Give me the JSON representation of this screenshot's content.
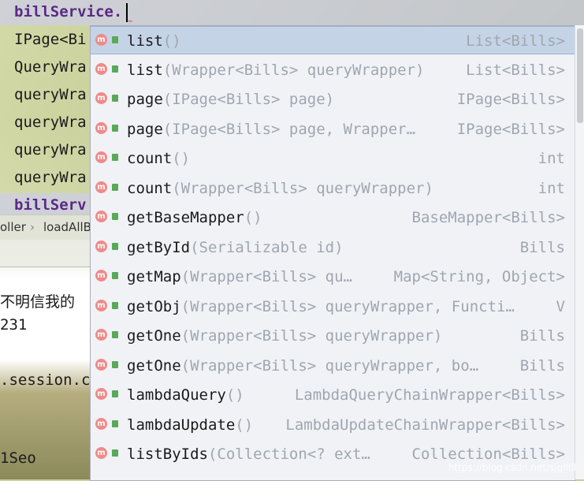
{
  "editor": {
    "lines": [
      {
        "text": "billService."
      },
      {
        "text": "IPage<Bi"
      },
      {
        "text": "QueryWra"
      },
      {
        "text": "queryWra"
      },
      {
        "text": "queryWra"
      },
      {
        "text": "queryWra"
      },
      {
        "text": "queryWra"
      },
      {
        "text": "billServ"
      }
    ]
  },
  "breadcrumb": {
    "item1": "oller",
    "separator": "›",
    "item2": "loadAllB"
  },
  "output": {
    "line1": "不明信我的",
    "line2": "231",
    "line3": ".session.c",
    "line4": "1Seo"
  },
  "completion": {
    "items": [
      {
        "name": "list",
        "params": "()",
        "type": "List<Bills>"
      },
      {
        "name": "list",
        "params": "(Wrapper<Bills> queryWrapper)",
        "type": "List<Bills>"
      },
      {
        "name": "page",
        "params": "(IPage<Bills> page)",
        "type": "IPage<Bills>"
      },
      {
        "name": "page",
        "params": "(IPage<Bills> page, Wrapper…",
        "type": "IPage<Bills>"
      },
      {
        "name": "count",
        "params": "()",
        "type": "int"
      },
      {
        "name": "count",
        "params": "(Wrapper<Bills> queryWrapper)",
        "type": "int"
      },
      {
        "name": "getBaseMapper",
        "params": "()",
        "type": "BaseMapper<Bills>"
      },
      {
        "name": "getById",
        "params": "(Serializable id)",
        "type": "Bills"
      },
      {
        "name": "getMap",
        "params": "(Wrapper<Bills> qu…",
        "type": "Map<String, Object>"
      },
      {
        "name": "getObj",
        "params": "(Wrapper<Bills> queryWrapper, Functi…",
        "type": "V"
      },
      {
        "name": "getOne",
        "params": "(Wrapper<Bills> queryWrapper)",
        "type": "Bills"
      },
      {
        "name": "getOne",
        "params": "(Wrapper<Bills> queryWrapper, bo…",
        "type": "Bills"
      },
      {
        "name": "lambdaQuery",
        "params": "()",
        "type": "LambdaQueryChainWrapper<Bills>"
      },
      {
        "name": "lambdaUpdate",
        "params": "()",
        "type": "LambdaUpdateChainWrapper<Bills>"
      },
      {
        "name": "listByIds",
        "params": "(Collection<? ext…",
        "type": "Collection<Bills>"
      }
    ],
    "icon_letter": "m",
    "selected_index": 0
  },
  "watermark": "https://blog.csdn.net/sjglllll"
}
